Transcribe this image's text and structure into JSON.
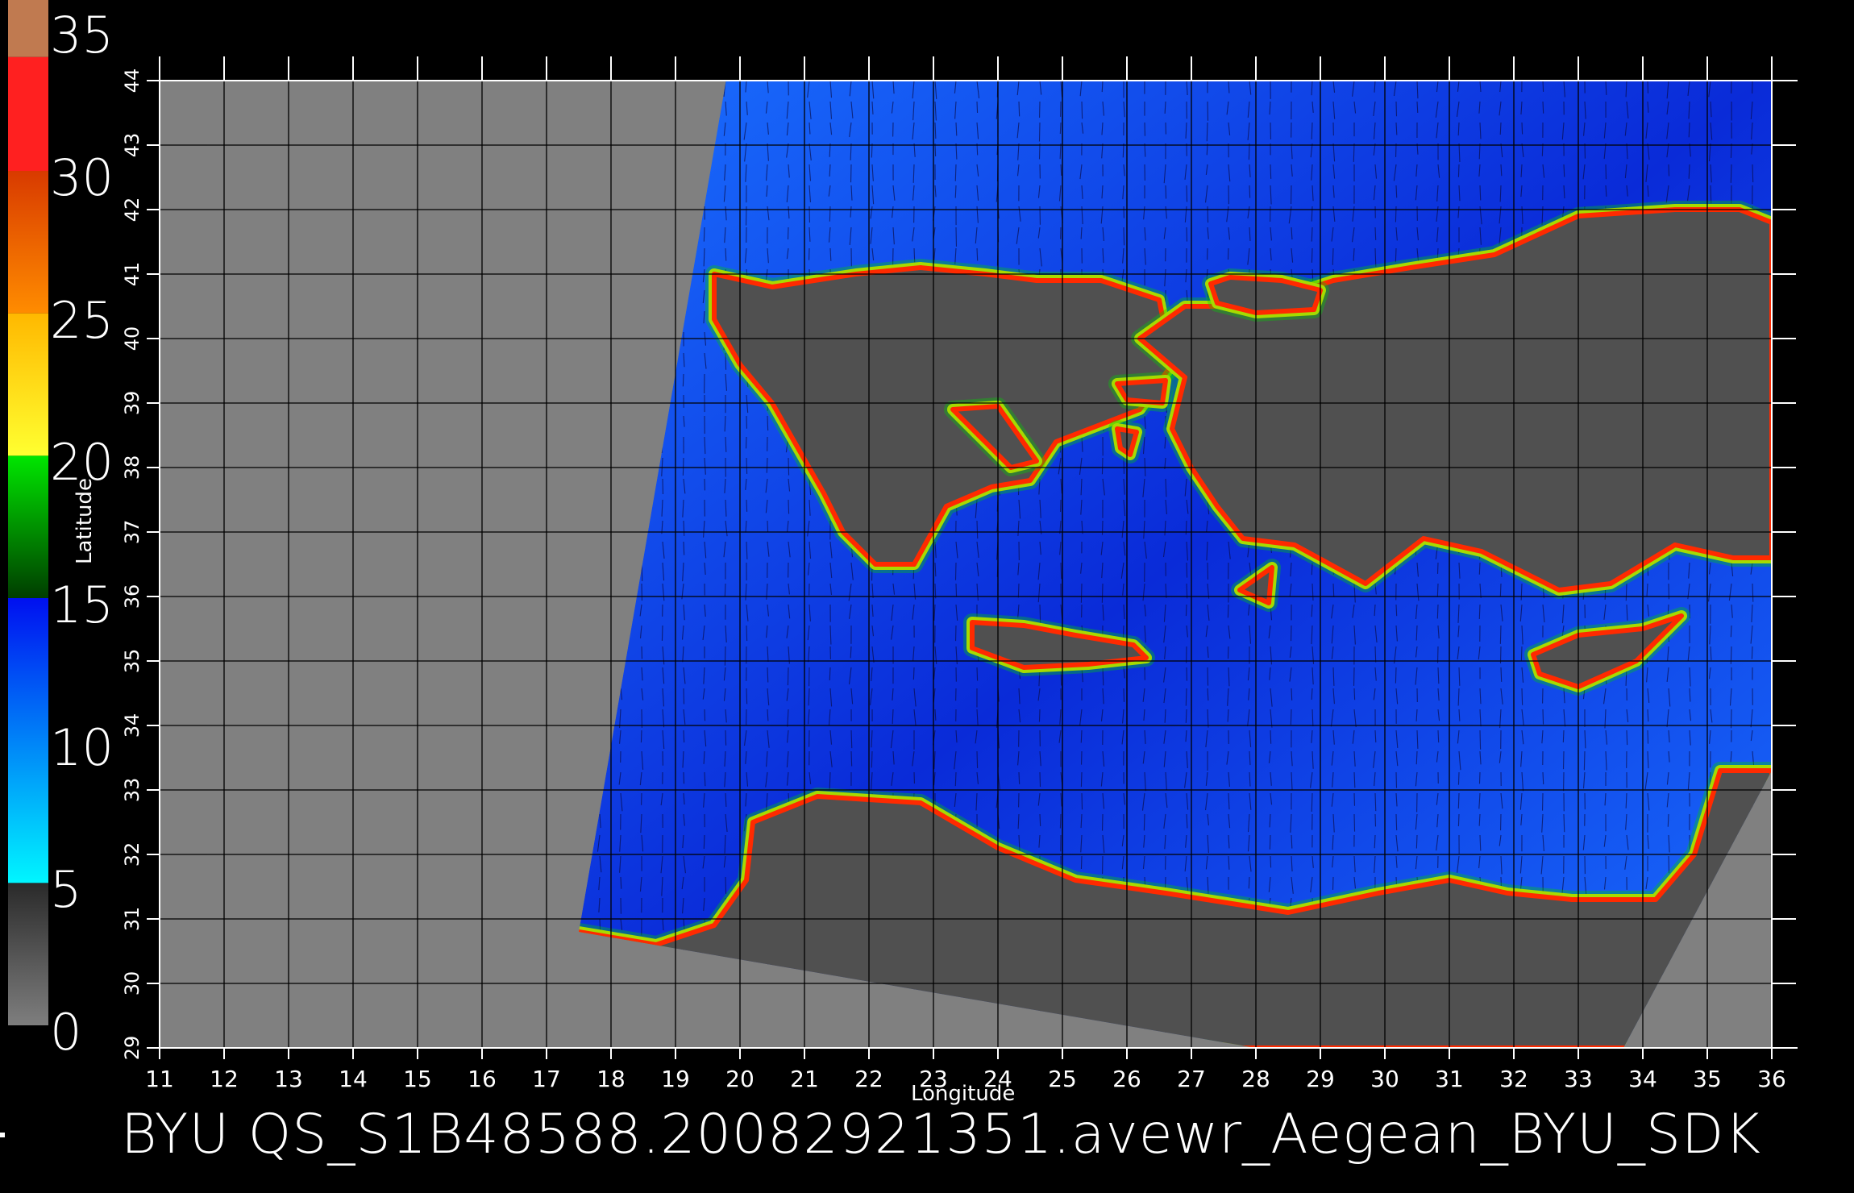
{
  "colorbar": {
    "labels": [
      "35",
      "30",
      "25",
      "20",
      "15",
      "10",
      "5",
      "0"
    ],
    "segments": [
      {
        "from": 0,
        "to": 5,
        "colors": [
          "#7e7e7e",
          "#2a2a2a"
        ]
      },
      {
        "from": 5,
        "to": 15,
        "colors": [
          "#00f6ff",
          "#0010f0"
        ]
      },
      {
        "from": 15,
        "to": 20,
        "colors": [
          "#003d00",
          "#00e600"
        ]
      },
      {
        "from": 20,
        "to": 25,
        "colors": [
          "#ffff30",
          "#ffb800"
        ]
      },
      {
        "from": 25,
        "to": 30,
        "colors": [
          "#ff8c00",
          "#d83a00"
        ]
      },
      {
        "from": 30,
        "to": 34,
        "colors": [
          "#ff2020",
          "#ff2020"
        ]
      },
      {
        "from": 34,
        "to": 36,
        "colors": [
          "#c07a50",
          "#c07a50"
        ]
      }
    ]
  },
  "map": {
    "xlabel": "Longitude",
    "ylabel": "Latitude",
    "lon_range": [
      11,
      36
    ],
    "lat_range": [
      29,
      44
    ],
    "lon_ticks": [
      "11",
      "12",
      "13",
      "14",
      "15",
      "16",
      "17",
      "18",
      "19",
      "20",
      "21",
      "22",
      "23",
      "24",
      "25",
      "26",
      "27",
      "28",
      "29",
      "30",
      "31",
      "32",
      "33",
      "34",
      "35",
      "36"
    ],
    "lat_ticks": [
      "29",
      "30",
      "31",
      "32",
      "33",
      "34",
      "35",
      "36",
      "37",
      "38",
      "39",
      "40",
      "41",
      "42",
      "43",
      "44"
    ],
    "colors": {
      "outside_swath": "#808080",
      "land": "#505050",
      "sea_low": "#1a6fff",
      "sea_high": "#0a2bd8",
      "coast": "#ff2a00",
      "grid": "#000000"
    },
    "swath_corners_lonlat": [
      [
        19.8,
        44.1
      ],
      [
        36.0,
        44.1
      ],
      [
        36.0,
        33.3
      ],
      [
        33.7,
        29.0
      ],
      [
        28.0,
        29.0
      ],
      [
        17.5,
        30.8
      ]
    ],
    "land": {
      "greece_mainland": [
        [
          19.6,
          41.0
        ],
        [
          20.5,
          40.8
        ],
        [
          21.8,
          41.0
        ],
        [
          22.8,
          41.1
        ],
        [
          23.8,
          41.0
        ],
        [
          24.6,
          40.9
        ],
        [
          25.6,
          40.9
        ],
        [
          26.5,
          40.6
        ],
        [
          26.7,
          39.6
        ],
        [
          26.2,
          38.9
        ],
        [
          24.9,
          38.4
        ],
        [
          24.5,
          37.8
        ],
        [
          23.9,
          37.7
        ],
        [
          23.2,
          37.4
        ],
        [
          22.7,
          36.5
        ],
        [
          22.1,
          36.5
        ],
        [
          21.6,
          37.0
        ],
        [
          21.3,
          37.6
        ],
        [
          20.9,
          38.3
        ],
        [
          20.5,
          39.0
        ],
        [
          20.0,
          39.6
        ],
        [
          19.6,
          40.3
        ]
      ],
      "anatolia": [
        [
          26.2,
          40.0
        ],
        [
          26.9,
          40.5
        ],
        [
          28.0,
          40.5
        ],
        [
          29.2,
          40.9
        ],
        [
          30.4,
          41.1
        ],
        [
          31.7,
          41.3
        ],
        [
          33.0,
          41.9
        ],
        [
          34.5,
          42.0
        ],
        [
          35.5,
          42.0
        ],
        [
          36.0,
          41.8
        ],
        [
          36.0,
          36.6
        ],
        [
          35.4,
          36.6
        ],
        [
          34.5,
          36.8
        ],
        [
          33.5,
          36.2
        ],
        [
          32.7,
          36.1
        ],
        [
          31.5,
          36.7
        ],
        [
          30.6,
          36.9
        ],
        [
          29.7,
          36.2
        ],
        [
          28.6,
          36.8
        ],
        [
          27.8,
          36.9
        ],
        [
          27.4,
          37.4
        ],
        [
          27.0,
          38.0
        ],
        [
          26.7,
          38.6
        ],
        [
          26.9,
          39.4
        ]
      ],
      "africa": [
        [
          17.5,
          30.8
        ],
        [
          18.7,
          30.6
        ],
        [
          19.6,
          30.9
        ],
        [
          20.1,
          31.6
        ],
        [
          20.2,
          32.5
        ],
        [
          21.2,
          32.9
        ],
        [
          22.8,
          32.8
        ],
        [
          24.0,
          32.1
        ],
        [
          25.2,
          31.6
        ],
        [
          26.6,
          31.4
        ],
        [
          28.5,
          31.1
        ],
        [
          29.9,
          31.4
        ],
        [
          31.0,
          31.6
        ],
        [
          31.9,
          31.4
        ],
        [
          32.9,
          31.3
        ],
        [
          34.2,
          31.3
        ],
        [
          34.8,
          32.0
        ],
        [
          35.2,
          33.3
        ],
        [
          36.0,
          33.3
        ],
        [
          36.0,
          29.0
        ],
        [
          17.5,
          29.0
        ]
      ],
      "crete": [
        [
          23.6,
          35.6
        ],
        [
          24.4,
          35.55
        ],
        [
          25.2,
          35.4
        ],
        [
          26.1,
          35.25
        ],
        [
          26.3,
          35.05
        ],
        [
          25.4,
          34.95
        ],
        [
          24.4,
          34.9
        ],
        [
          23.6,
          35.2
        ]
      ],
      "cyprus": [
        [
          32.3,
          35.1
        ],
        [
          33.0,
          35.4
        ],
        [
          34.0,
          35.5
        ],
        [
          34.6,
          35.7
        ],
        [
          33.9,
          35.0
        ],
        [
          33.0,
          34.6
        ],
        [
          32.4,
          34.8
        ]
      ],
      "rhodes": [
        [
          27.75,
          36.1
        ],
        [
          28.25,
          36.45
        ],
        [
          28.2,
          35.9
        ]
      ],
      "lesbos": [
        [
          25.85,
          39.3
        ],
        [
          26.6,
          39.35
        ],
        [
          26.55,
          39.0
        ],
        [
          26.0,
          39.05
        ]
      ],
      "chios": [
        [
          25.85,
          38.6
        ],
        [
          26.15,
          38.55
        ],
        [
          26.05,
          38.2
        ],
        [
          25.9,
          38.3
        ]
      ],
      "euboea": [
        [
          23.3,
          38.9
        ],
        [
          24.0,
          38.95
        ],
        [
          24.6,
          38.1
        ],
        [
          24.2,
          38.0
        ]
      ],
      "marmara": [
        [
          27.3,
          40.85
        ],
        [
          27.6,
          40.95
        ],
        [
          28.4,
          40.9
        ],
        [
          29.0,
          40.75
        ],
        [
          28.9,
          40.45
        ],
        [
          28.0,
          40.4
        ],
        [
          27.4,
          40.55
        ]
      ]
    }
  },
  "footer": {
    "caption": "BYU  QS_S1B48588.20082921351.avewr_Aegean_BYU_SDK"
  }
}
